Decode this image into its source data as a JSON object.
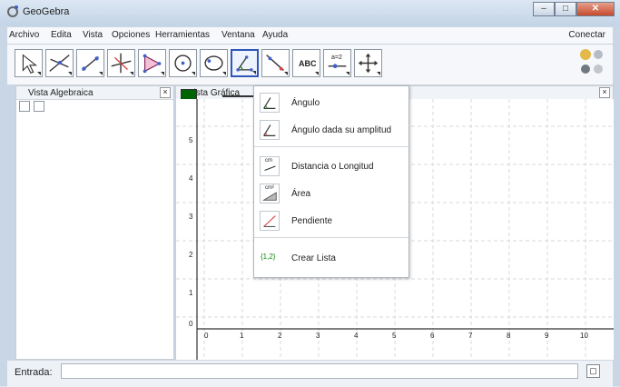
{
  "window": {
    "title": "GeoGebra"
  },
  "menu": {
    "items": [
      "Archivo",
      "Edita",
      "Vista",
      "Opciones",
      "Herramientas",
      "Ventana",
      "Ayuda"
    ],
    "connect": "Conectar"
  },
  "toolbar": {
    "tools": [
      "Mover",
      "Punto",
      "Línea",
      "Perpendicular",
      "Polígono",
      "Circunferencia",
      "Cónica",
      "Ángulo",
      "Recta",
      "Texto",
      "Deslizador",
      "Desplazar"
    ]
  },
  "panels": {
    "algebra": "Vista Algebraica",
    "graphics": "Vista Gráfica"
  },
  "dropdown": {
    "items": [
      {
        "label": "Ángulo",
        "icon": "angle-icon"
      },
      {
        "label": "Ángulo dada su amplitud",
        "icon": "angle-given-icon"
      },
      {
        "label": "Distancia o Longitud",
        "icon": "distance-icon"
      },
      {
        "label": "Área",
        "icon": "area-icon"
      },
      {
        "label": "Pendiente",
        "icon": "slope-icon"
      },
      {
        "label": "Crear Lista",
        "icon": "list-icon"
      }
    ]
  },
  "text_tool": {
    "label": "ABC"
  },
  "slider_tool": {
    "label": "a=2"
  },
  "list_icon_text": "{1,2}",
  "area_icon_text": "cm²",
  "distance_icon_text": "cm",
  "axis": {
    "x_ticks": [
      "0",
      "1",
      "2",
      "3",
      "4",
      "5",
      "6",
      "7",
      "8",
      "9",
      "10"
    ],
    "y_ticks": [
      "5",
      "4",
      "3",
      "2",
      "1",
      "0"
    ]
  },
  "input": {
    "label": "Entrada:"
  },
  "colors": {
    "accent": "#2f56b8",
    "green": "#006400"
  }
}
